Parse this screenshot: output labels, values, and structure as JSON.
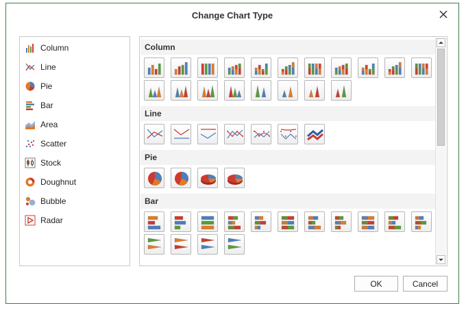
{
  "dialog": {
    "title": "Change Chart Type"
  },
  "types": [
    {
      "label": "Column",
      "icon": "column-chart-icon"
    },
    {
      "label": "Line",
      "icon": "line-chart-icon"
    },
    {
      "label": "Pie",
      "icon": "pie-chart-icon"
    },
    {
      "label": "Bar",
      "icon": "bar-chart-icon"
    },
    {
      "label": "Area",
      "icon": "area-chart-icon"
    },
    {
      "label": "Scatter",
      "icon": "scatter-chart-icon"
    },
    {
      "label": "Stock",
      "icon": "stock-chart-icon"
    },
    {
      "label": "Doughnut",
      "icon": "doughnut-chart-icon"
    },
    {
      "label": "Bubble",
      "icon": "bubble-chart-icon"
    },
    {
      "label": "Radar",
      "icon": "radar-chart-icon"
    }
  ],
  "gallery": {
    "sections": [
      {
        "title": "Column",
        "count": 19
      },
      {
        "title": "Line",
        "count": 7
      },
      {
        "title": "Pie",
        "count": 4
      },
      {
        "title": "Bar",
        "count": 15
      }
    ]
  },
  "buttons": {
    "ok": "OK",
    "cancel": "Cancel"
  },
  "colors": {
    "orange": "#e07b2a",
    "blue": "#4a7fc0",
    "red": "#cc3b2e",
    "green": "#5a9a3a",
    "border": "#3a7d45"
  }
}
